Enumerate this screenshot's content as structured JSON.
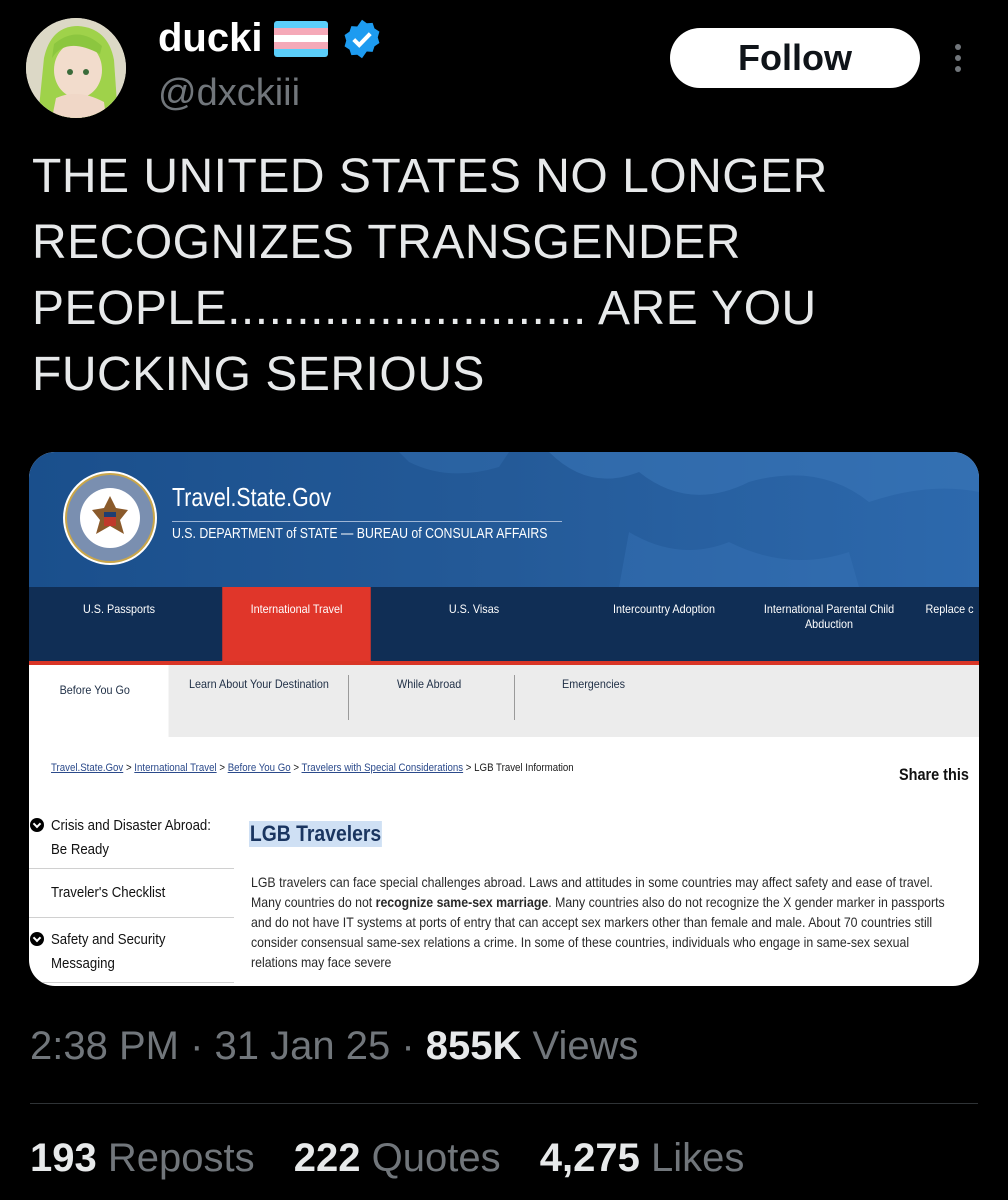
{
  "author": {
    "display_name": "ducki",
    "handle": "@dxckiii",
    "flag_colors": [
      "#5bcefa",
      "#f5a9b8",
      "#ffffff",
      "#f5a9b8",
      "#5bcefa"
    ],
    "verified_color": "#1d9bf0"
  },
  "follow_label": "Follow",
  "tweet_text": "THE UNITED STATES NO LONGER RECOGNIZES TRANSGENDER PEOPLE.......................... ARE YOU FUCKING SERIOUS",
  "embedded": {
    "site_title": "Travel.State.Gov",
    "site_subtitle": "U.S. DEPARTMENT of STATE — BUREAU of CONSULAR AFFAIRS",
    "seal_ring_text": "DEPARTMENT OF STATE · UNITED STATES OF AMERICA",
    "nav": [
      "U.S. Passports",
      "International Travel",
      "U.S. Visas",
      "Intercountry Adoption",
      "International Parental Child Abduction",
      "Replace c"
    ],
    "subnav": [
      "Before You Go",
      "Learn About Your Destination",
      "While Abroad",
      "Emergencies"
    ],
    "breadcrumb": [
      "Travel.State.Gov",
      "International Travel",
      "Before You Go",
      "Travelers with Special Considerations",
      "LGB Travel Information"
    ],
    "share": "Share this",
    "side_items": [
      "Crisis and Disaster Abroad: Be Ready",
      "Traveler's Checklist",
      "Safety and Security Messaging"
    ],
    "heading": "LGB Travelers",
    "body_parts": [
      "LGB travelers can face special challenges abroad. Laws and attitudes in some countries may affect safety and ease of travel. Many countries do not ",
      "recognize same-sex marriage",
      ". Many countries also do not recognize the X gender marker in passports and do not have IT systems at ports of entry that can accept sex markers other than female and male. About 70 countries still consider consensual same-sex relations a crime. In some of these countries, individuals who engage in same-sex sexual relations may face severe"
    ],
    "colors": {
      "nav_bg": "#102e55",
      "active_tab": "#e0362a",
      "banner": "#245a98"
    }
  },
  "meta": {
    "time": "2:38 PM",
    "date": "31 Jan 25",
    "views_count": "855K",
    "views_label": "Views"
  },
  "stats": [
    {
      "count": "193",
      "label": "Reposts"
    },
    {
      "count": "222",
      "label": "Quotes"
    },
    {
      "count": "4,275",
      "label": "Likes"
    }
  ]
}
